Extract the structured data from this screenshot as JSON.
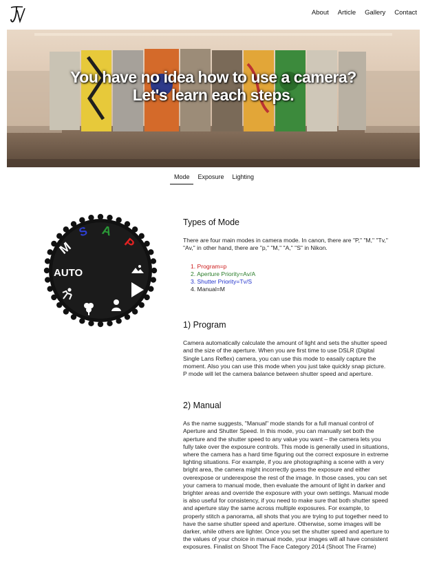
{
  "logo_text": "JV",
  "nav": [
    "About",
    "Article",
    "Gallery",
    "Contact"
  ],
  "hero": {
    "line1": "You have no idea how to use a camera?",
    "line2": "Let's learn each steps."
  },
  "tabs": [
    "Mode",
    "Exposure",
    "Lighting"
  ],
  "dial": {
    "labels": [
      "AUTO",
      "M",
      "S",
      "A",
      "P"
    ],
    "colors": {
      "M": "#ffffff",
      "S": "#2e3fd1",
      "A": "#2a9a37",
      "P": "#e02222",
      "AUTO": "#ffffff"
    },
    "icons": [
      "landscape-icon",
      "portrait-icon",
      "macro-icon",
      "sports-icon",
      "night-icon",
      "play-icon"
    ]
  },
  "types": {
    "heading": "Types of Mode",
    "intro": "There are four main modes in camera mode. In canon, there are \"P,\" \"M,\" \"Tv,\" \"Av,\" in other hand, there are \"p,\" \"M,\" \"A,\" \"S\" in Nikon.",
    "modes": [
      {
        "text": "1. Program=p",
        "color": "#cc1a1a"
      },
      {
        "text": "2. Aperture Priority=Av/A",
        "color": "#2a7d2a"
      },
      {
        "text": "3. Shutter Priority=Tv/S",
        "color": "#2233cc"
      },
      {
        "text": "4. Manual=M",
        "color": "#222222"
      }
    ]
  },
  "program": {
    "heading": "1) Program",
    "body": "Camera automatically calculate the amount of light and sets the shutter speed and the size of the aperture. When you are first time to use DSLR (Digital Single Lans Reflex) camera, you can use this mode to easaily capture the moment. Also you can use this mode when you just take quickly snap picture. P mode will let the camera balance between shutter speed and aperture."
  },
  "manual": {
    "heading": "2) Manual",
    "body": "As the name suggests, \"Manual\" mode stands for a full manual control of Aperture and Shutter Speed. In this mode, you can manually set both the aperture and the shutter speed to any value you want – the camera lets you fully take over the exposure controls. This mode is generally used in situations, where the camera has a hard time figuring out the correct exposure in extreme lighting situations. For example, if you are photographing a scene with a very bright area, the camera might incorrectly guess the exposure and either overexpose or underexpose the rest of the image. In those cases, you can set your camera to manual mode, then evaluate the amount of light in darker and brighter areas and override the exposure with your own settings. Manual mode is also useful for consistency, if you need to make sure that both shutter speed and aperture stay the same across multiple exposures. For example, to properly stitch a panorama, all shots that you are trying to put together need to have the same shutter speed and aperture. Otherwise, some images will be darker, while others are lighter. Once you set the shutter speed and aperture to the values of your choice in manual mode, your images will all have consistent exposures. Finalist on Shoot The Face Category 2014 (Shoot The Frame)"
  }
}
